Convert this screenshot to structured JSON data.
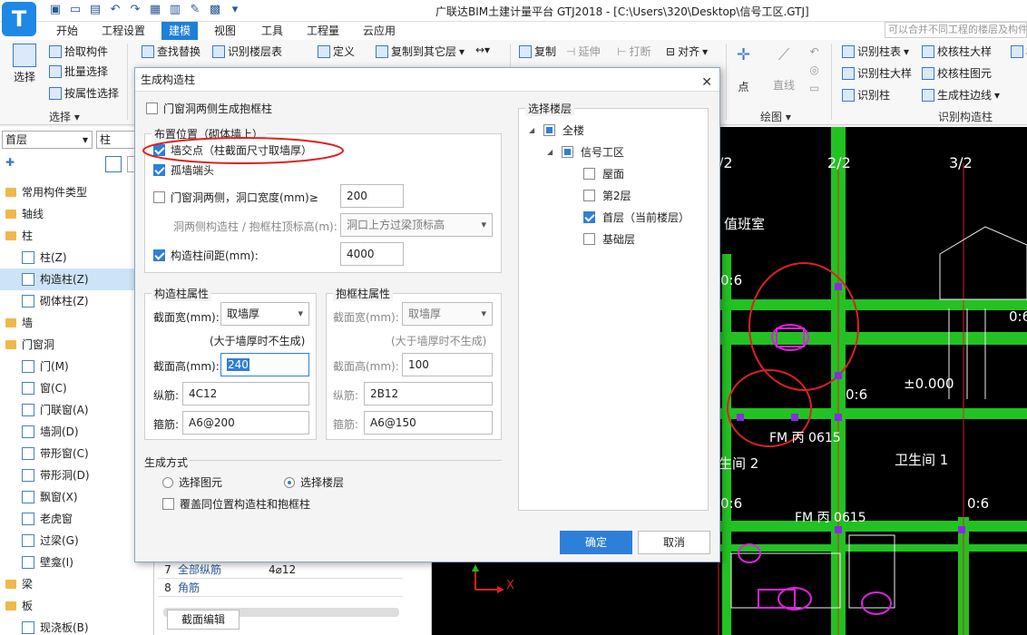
{
  "window": {
    "title": "广联达BIM土建计量平台 GTJ2018 - [C:\\Users\\320\\Desktop\\信号工区.GTJ]",
    "logo": "T"
  },
  "menu": {
    "tabs": [
      "开始",
      "工程设置",
      "建模",
      "视图",
      "工具",
      "工程量",
      "云应用"
    ],
    "active": "建模",
    "search_placeholder": "可以合并不同工程的楼层及构件"
  },
  "ribbon": {
    "select_label": "选择",
    "select_group": "选择",
    "pick_component": "拾取构件",
    "batch_select": "批量选择",
    "attr_select": "按属性选择",
    "find_replace": "查找替换",
    "identify_floor_table": "识别楼层表",
    "define": "定义",
    "copy_to_floor": "复制到其它层",
    "copy": "复制",
    "extend": "延伸",
    "break": "打断",
    "align": "对齐",
    "point": "点",
    "line": "直线",
    "draw_group": "绘图",
    "identify_column_table": "识别柱表",
    "identify_column_detail": "识别柱大样",
    "identify_column": "识别柱",
    "check_column_detail": "校核柱大样",
    "check_column_element": "校核柱图元",
    "gen_column_edge": "生成柱边线",
    "identify_group": "识别构造柱",
    "check_partial": "校"
  },
  "left_panel": {
    "floor": "首层",
    "type": "柱",
    "tree": [
      {
        "label": "常用构件类型",
        "kind": "folder",
        "indent": 0
      },
      {
        "label": "轴线",
        "kind": "folder",
        "indent": 0
      },
      {
        "label": "柱",
        "kind": "folder",
        "indent": 0
      },
      {
        "label": "柱(Z)",
        "kind": "item",
        "indent": 1
      },
      {
        "label": "构造柱(Z)",
        "kind": "item",
        "indent": 1
      },
      {
        "label": "砌体柱(Z)",
        "kind": "item",
        "indent": 1
      },
      {
        "label": "墙",
        "kind": "folder",
        "indent": 0
      },
      {
        "label": "门窗洞",
        "kind": "folder",
        "indent": 0
      },
      {
        "label": "门(M)",
        "kind": "item",
        "indent": 1
      },
      {
        "label": "窗(C)",
        "kind": "item",
        "indent": 1
      },
      {
        "label": "门联窗(A)",
        "kind": "item",
        "indent": 1
      },
      {
        "label": "墙洞(D)",
        "kind": "item",
        "indent": 1
      },
      {
        "label": "带形窗(C)",
        "kind": "item",
        "indent": 1
      },
      {
        "label": "带形洞(D)",
        "kind": "item",
        "indent": 1
      },
      {
        "label": "飘窗(X)",
        "kind": "item",
        "indent": 1
      },
      {
        "label": "老虎窗",
        "kind": "item",
        "indent": 1
      },
      {
        "label": "过梁(G)",
        "kind": "item",
        "indent": 1
      },
      {
        "label": "壁龛(I)",
        "kind": "item",
        "indent": 1
      },
      {
        "label": "梁",
        "kind": "folder",
        "indent": 0
      },
      {
        "label": "板",
        "kind": "folder",
        "indent": 0
      },
      {
        "label": "现浇板(B)",
        "kind": "item",
        "indent": 1
      }
    ],
    "selected": "构造柱(Z)"
  },
  "props_panel": {
    "rows": [
      {
        "num": "7",
        "name": "全部纵筋",
        "value": "4⌀12"
      },
      {
        "num": "8",
        "name": "角筋",
        "value": ""
      }
    ],
    "section_edit": "截面编辑"
  },
  "canvas": {
    "axis_labels": [
      "2/2",
      "3/2",
      "/2"
    ],
    "room_labels": [
      "值班室",
      "卫生间 1",
      "生间 2"
    ],
    "level": "±0.000",
    "door_labels": [
      "FM 丙 0615",
      "FM 丙 0615"
    ],
    "dims": [
      "0:6",
      "0:6",
      "0:6",
      "0:6",
      "0:6"
    ],
    "axis_x": "X"
  },
  "dialog": {
    "title": "生成构造柱",
    "gen_at_openings": "门窗洞两侧生成抱框柱",
    "placement_legend": "布置位置（砌体墙上）",
    "wall_junction": "墙交点（柱截面尺寸取墙厚）",
    "wall_end": "孤墙端头",
    "opening_sides": "门窗洞两侧，洞口宽度(mm)≥",
    "opening_width": "200",
    "top_elev_label": "洞两侧构造柱 / 抱框柱顶标高(m):",
    "top_elev_value": "洞口上方过梁顶标高",
    "spacing_label": "构造柱间距(mm):",
    "spacing_value": "4000",
    "col_props_legend": "构造柱属性",
    "col_width_label": "截面宽(mm):",
    "col_width_value": "取墙厚",
    "col_note": "(大于墙厚时不生成)",
    "col_height_label": "截面高(mm):",
    "col_height_value": "240",
    "col_long_label": "纵筋:",
    "col_long_value": "4C12",
    "col_stirrup_label": "箍筋:",
    "col_stirrup_value": "A6@200",
    "frame_props_legend": "抱框柱属性",
    "frame_width_label": "截面宽(mm):",
    "frame_width_value": "取墙厚",
    "frame_note": "(大于墙厚时不生成)",
    "frame_height_label": "截面高(mm):",
    "frame_height_value": "100",
    "frame_long_label": "纵筋:",
    "frame_long_value": "2B12",
    "frame_stirrup_label": "箍筋:",
    "frame_stirrup_value": "A6@150",
    "gen_mode_legend": "生成方式",
    "mode_element": "选择图元",
    "mode_floor": "选择楼层",
    "override": "覆盖同位置构造柱和抱框柱",
    "floor_legend": "选择楼层",
    "floor_all": "全楼",
    "floor_project": "信号工区",
    "floors": [
      "屋面",
      "第2层",
      "首层（当前楼层）",
      "基础层"
    ],
    "ok": "确定",
    "cancel": "取消"
  },
  "colors": {
    "accent": "#2e7fd8",
    "wall_green": "#22c222",
    "annotation_red": "#e02020",
    "cad_magenta": "#e020e0"
  }
}
